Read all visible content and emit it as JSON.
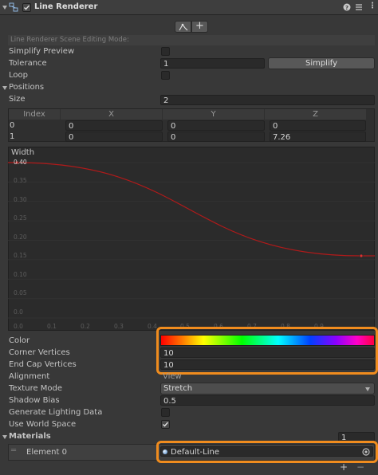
{
  "header": {
    "title": "Line Renderer",
    "checked": true
  },
  "toolbar": {
    "edit_icon": "edit-points-icon",
    "add_icon": "plus-icon"
  },
  "scene_mode_label": "Line Renderer Scene Editing Mode:",
  "simplify_preview": {
    "label": "Simplify Preview",
    "checked": false
  },
  "tolerance": {
    "label": "Tolerance",
    "value": "1",
    "button": "Simplify"
  },
  "loop": {
    "label": "Loop",
    "checked": false
  },
  "positions": {
    "label": "Positions",
    "size_label": "Size",
    "size": "2",
    "columns": [
      "Index",
      "X",
      "Y",
      "Z"
    ],
    "rows": [
      {
        "index": "0",
        "x": "0",
        "y": "0",
        "z": "0"
      },
      {
        "index": "1",
        "x": "0",
        "y": "0",
        "z": "7.26"
      }
    ]
  },
  "chart_data": {
    "type": "line",
    "title": "Width",
    "x": [
      0.0,
      1.0
    ],
    "series": [
      {
        "values": [
          0.4,
          0.16
        ]
      }
    ],
    "ylim": [
      0.0,
      0.4
    ],
    "xlim": [
      0.0,
      1.0
    ],
    "yticks": [
      "0.40",
      "0.35",
      "0.30",
      "0.25",
      "0.20",
      "0.15",
      "0.10",
      "0.05",
      "0.0"
    ],
    "xticks": [
      "0.0",
      "0.1",
      "0.2",
      "0.3",
      "0.4",
      "0.5",
      "0.6",
      "0.7",
      "0.8",
      "0.9"
    ],
    "line_color": "#b01a1a"
  },
  "color": {
    "label": "Color"
  },
  "corner_vertices": {
    "label": "Corner Vertices",
    "value": "10"
  },
  "end_cap_vertices": {
    "label": "End Cap Vertices",
    "value": "10"
  },
  "alignment": {
    "label": "Alignment",
    "value": "View"
  },
  "texture_mode": {
    "label": "Texture Mode",
    "value": "Stretch"
  },
  "shadow_bias": {
    "label": "Shadow Bias",
    "value": "0.5"
  },
  "generate_lighting": {
    "label": "Generate Lighting Data",
    "checked": false
  },
  "use_world_space": {
    "label": "Use World Space",
    "checked": true
  },
  "materials": {
    "label": "Materials",
    "count": "1",
    "element_label": "Element 0",
    "element_value": "Default-Line"
  },
  "highlight_color": "#f08c1e"
}
